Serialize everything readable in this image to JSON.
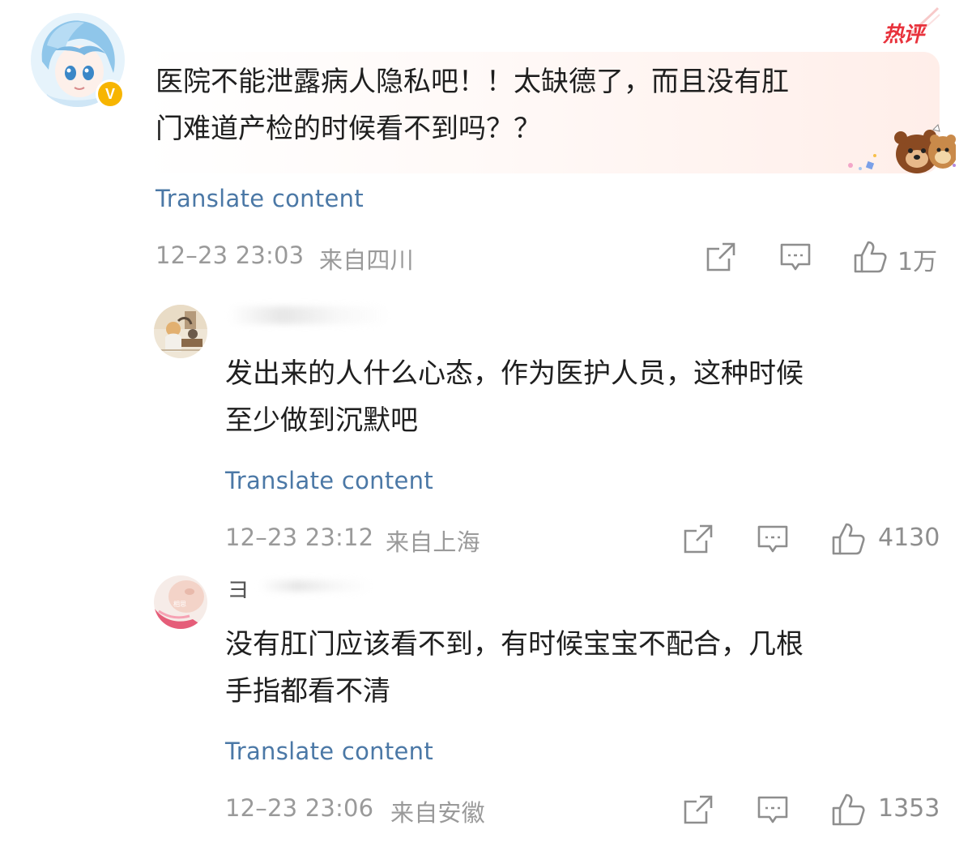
{
  "comments": [
    {
      "text": "医院不能泄露病人隐私吧！！太缺德了，而且没有肛\n门难道产检的时候看不到吗？？",
      "translate_label": "Translate content",
      "date_time": "12–23 23:03",
      "location": "来自四川",
      "likes": "1万",
      "badge": "热评",
      "verified_badge": "V",
      "icons": [
        "share-icon",
        "comment-icon",
        "like-icon"
      ]
    },
    {
      "text": "发出来的人什么心态，作为医护人员，这种时候\n至少做到沉默吧",
      "translate_label": "Translate content",
      "date_time": "12–23 23:12",
      "location": "来自上海",
      "likes": "4130"
    },
    {
      "name_fragment": "ヨ",
      "avatar_caption": "相思",
      "text": "没有肛门应该看不到，有时候宝宝不配合，几根\n手指都看不清",
      "translate_label": "Translate content",
      "date_time": "12–23 23:06",
      "location": "来自安徽",
      "likes": "1353"
    }
  ],
  "colors": {
    "link": "#4b78a6",
    "meta": "#9a9a9a",
    "hot_badge": "#e8323c",
    "verified": "#f7b500"
  }
}
